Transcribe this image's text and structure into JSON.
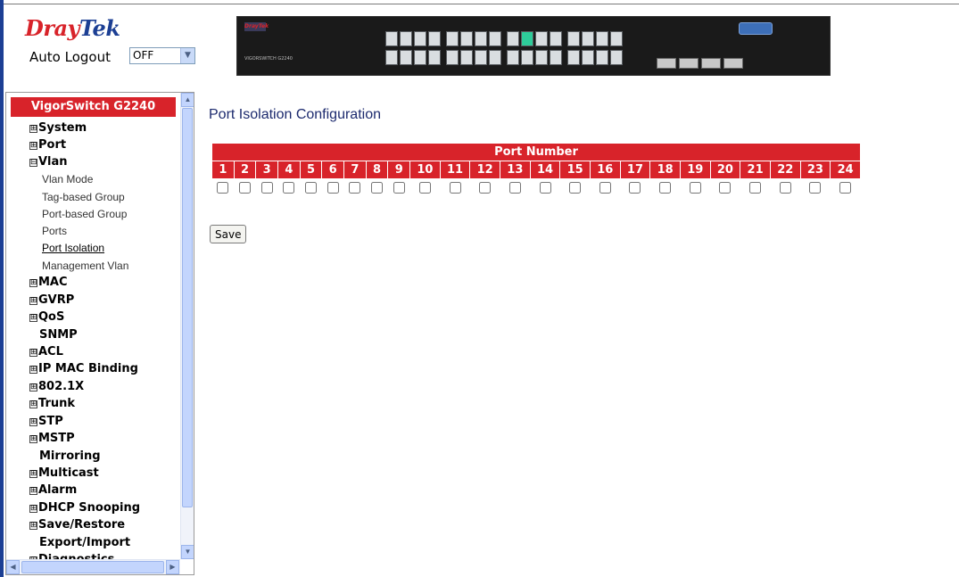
{
  "header": {
    "brand_part1": "Dray",
    "brand_part2": "Tek",
    "auto_logout_label": "Auto Logout",
    "auto_logout_value": "OFF"
  },
  "colors": {
    "brand_red": "#d8232a",
    "brand_blue": "#1c3f94",
    "title_blue": "#1c2a6e"
  },
  "sidebar": {
    "title": "VigorSwitch G2240",
    "expand_icon": "plus-box-icon",
    "collapse_icon": "minus-box-icon",
    "nodes": [
      {
        "label": "System",
        "expander": "⊞"
      },
      {
        "label": "Port",
        "expander": "⊞"
      },
      {
        "label": "Vlan",
        "expander": "⊟"
      },
      {
        "label": "MAC",
        "expander": "⊞"
      },
      {
        "label": "GVRP",
        "expander": "⊞"
      },
      {
        "label": "QoS",
        "expander": "⊞"
      },
      {
        "label": "SNMP"
      },
      {
        "label": "ACL",
        "expander": "⊞"
      },
      {
        "label": "IP MAC Binding",
        "expander": "⊞"
      },
      {
        "label": "802.1X",
        "expander": "⊞"
      },
      {
        "label": "Trunk",
        "expander": "⊞"
      },
      {
        "label": "STP",
        "expander": "⊞"
      },
      {
        "label": "MSTP",
        "expander": "⊞"
      },
      {
        "label": "Mirroring"
      },
      {
        "label": "Multicast",
        "expander": "⊞"
      },
      {
        "label": "Alarm",
        "expander": "⊞"
      },
      {
        "label": "DHCP Snooping",
        "expander": "⊞"
      },
      {
        "label": "Save/Restore",
        "expander": "⊞"
      },
      {
        "label": "Export/Import"
      },
      {
        "label": "Diagnostics",
        "expander": "⊞"
      }
    ],
    "vlan_children": [
      "Vlan Mode",
      "Tag-based Group",
      "Port-based Group",
      "Ports",
      "Port Isolation",
      "Management Vlan"
    ]
  },
  "main": {
    "title": "Port Isolation Configuration",
    "table_header": "Port Number",
    "ports": [
      "1",
      "2",
      "3",
      "4",
      "5",
      "6",
      "7",
      "8",
      "9",
      "10",
      "11",
      "12",
      "13",
      "14",
      "15",
      "16",
      "17",
      "18",
      "19",
      "20",
      "21",
      "22",
      "23",
      "24"
    ],
    "checked": [
      false,
      false,
      false,
      false,
      false,
      false,
      false,
      false,
      false,
      false,
      false,
      false,
      false,
      false,
      false,
      false,
      false,
      false,
      false,
      false,
      false,
      false,
      false,
      false
    ],
    "save_label": "Save"
  }
}
